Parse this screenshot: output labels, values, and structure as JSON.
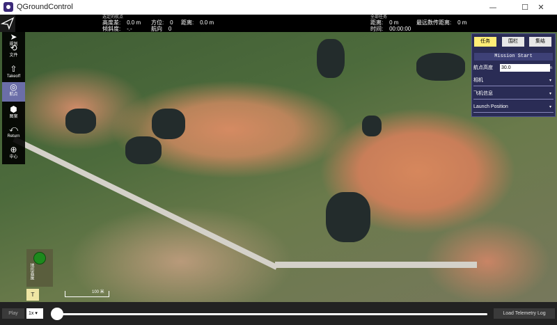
{
  "window": {
    "title": "QGroundControl",
    "minimize": "—",
    "maximize": "☐",
    "close": "✕"
  },
  "toolbar": {
    "selected_waypoint": {
      "heading_label": "选定的航点",
      "alt_diff": "高度差:    0.0 m",
      "azimuth": "方位:    0",
      "distance": "距离:    0.0 m",
      "gradient": "倾斜度:    -.-",
      "heading": "航向    0"
    },
    "total_mission": {
      "heading_label": "全部任务",
      "distance": "距离:    0 m",
      "max_telem_dist": "最远数传距离:    0 m",
      "time": "时间:    00:00:00"
    }
  },
  "left_tools": [
    {
      "name": "plan",
      "label": "规划",
      "icon": "paper-plane-icon"
    },
    {
      "name": "file",
      "label": "文件",
      "icon": "sync-icon"
    },
    {
      "name": "takeoff",
      "label": "Takeoff",
      "icon": "takeoff-icon"
    },
    {
      "name": "waypoint",
      "label": "航点",
      "icon": "waypoint-icon"
    },
    {
      "name": "pattern",
      "label": "图案",
      "icon": "pattern-icon"
    },
    {
      "name": "return",
      "label": "Return",
      "icon": "return-icon"
    },
    {
      "name": "center",
      "label": "中心",
      "icon": "crosshair-icon"
    }
  ],
  "mission_panel": {
    "tabs": [
      "任务",
      "围栏",
      "集结"
    ],
    "header": "Mission Start",
    "alt_label": "航点高度",
    "alt_value": "30.0",
    "alt_unit": "m",
    "camera_label": "相机",
    "vehicle_label": "飞机信息",
    "launch_label": "Launch Position",
    "arrow": "▾"
  },
  "map": {
    "compass_text": "地形高度",
    "map_type_button": "T",
    "scale_label": "100 米"
  },
  "playback": {
    "play": "Play",
    "speed": "1x ▾",
    "load_log": "Load Telemetry Log",
    "progress": 0
  },
  "colors": {
    "panel": "#2a2c55",
    "tab_selected": "#ffed76",
    "toolbar": "#000000",
    "active_tool": "#6b6ea8"
  }
}
